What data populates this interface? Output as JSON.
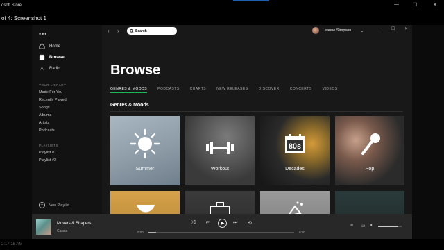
{
  "store_window": {
    "title": "Microsoft Store",
    "visible_title": "osoft Store"
  },
  "viewer": {
    "title": "of 4: Screenshot 1"
  },
  "bottom_strip": {
    "text": "2:17:15 AM"
  },
  "sidebar": {
    "menu_icon": "ellipsis-icon",
    "nav": [
      {
        "label": "Home",
        "icon": "home-icon",
        "active": false
      },
      {
        "label": "Browse",
        "icon": "browse-icon",
        "active": true
      },
      {
        "label": "Radio",
        "icon": "radio-icon",
        "active": false
      }
    ],
    "library_heading": "YOUR LIBRARY",
    "library": [
      "Made For You",
      "Recently Played",
      "Songs",
      "Albums",
      "Artists",
      "Podcasts"
    ],
    "playlists_heading": "PLAYLISTS",
    "playlists": [
      "Playlist #1",
      "Playlist #2"
    ],
    "new_playlist": "New Playlist"
  },
  "topbar": {
    "search_placeholder": "Search",
    "user_name": "Leanne Simpson"
  },
  "page": {
    "title": "Browse",
    "tabs": [
      {
        "label": "GENRES & MOODS",
        "active": true
      },
      {
        "label": "PODCASTS"
      },
      {
        "label": "CHARTS"
      },
      {
        "label": "NEW RELEASES"
      },
      {
        "label": "DISCOVER"
      },
      {
        "label": "CONCERTS"
      },
      {
        "label": "VIDEOS"
      }
    ],
    "section_heading": "Genres & Moods",
    "tiles": [
      {
        "label": "Summer",
        "icon": "sun-icon"
      },
      {
        "label": "Workout",
        "icon": "dumbbell-icon"
      },
      {
        "label": "Decades",
        "icon": "calendar-80s-icon"
      },
      {
        "label": "Pop",
        "icon": "microphone-icon"
      }
    ]
  },
  "player": {
    "track": "Movers & Shapers",
    "artist": "Cassia",
    "elapsed": "0:00",
    "duration": "0:00",
    "progress": 0.05,
    "volume": 0.85
  },
  "colors": {
    "accent": "#1db954",
    "background": "#181818",
    "sidebar": "#121212",
    "player": "#282828"
  }
}
